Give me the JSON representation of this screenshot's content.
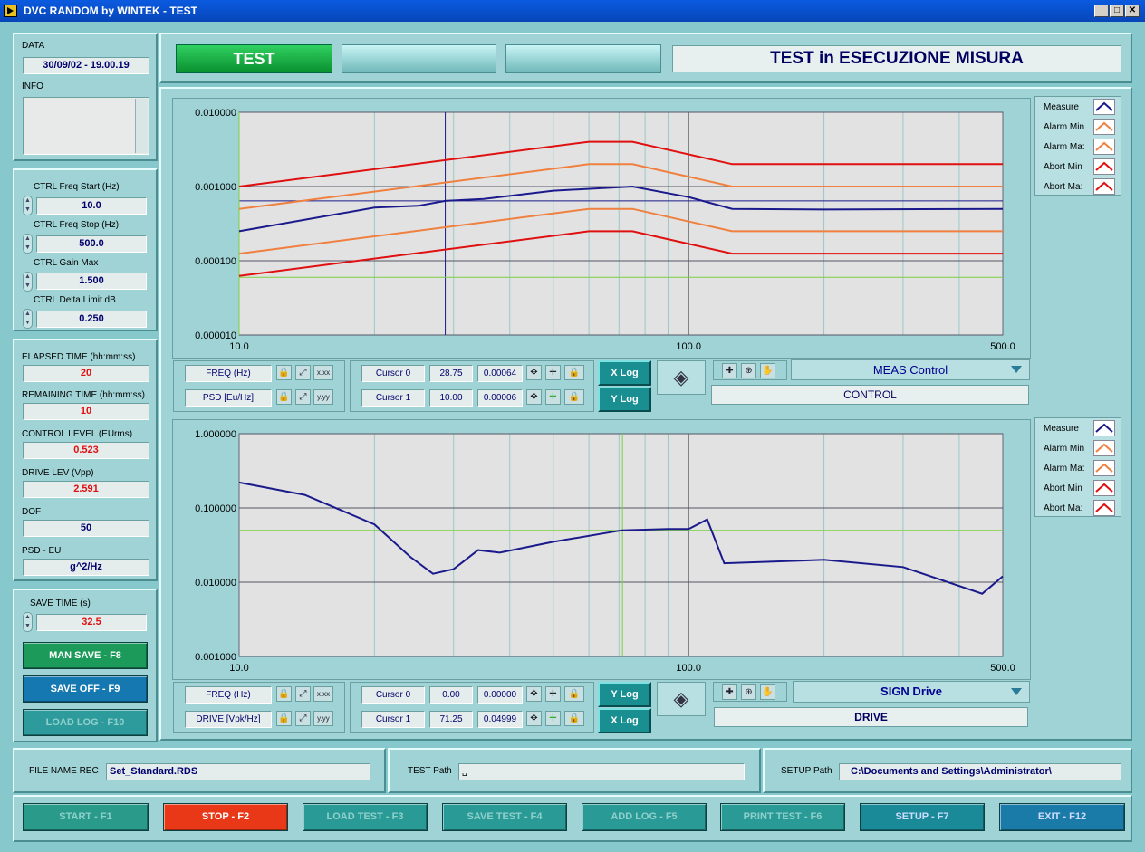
{
  "window": {
    "title": "DVC RANDOM by WINTEK - TEST",
    "min": "_",
    "max": "□",
    "close": "✕"
  },
  "left": {
    "data_label": "DATA",
    "data_value": "30/09/02 - 19.00.19",
    "info_label": "INFO",
    "ctrl_freq_start_label": "CTRL Freq Start (Hz)",
    "ctrl_freq_start": "10.0",
    "ctrl_freq_stop_label": "CTRL Freq Stop (Hz)",
    "ctrl_freq_stop": "500.0",
    "ctrl_gain_max_label": "CTRL Gain Max",
    "ctrl_gain_max": "1.500",
    "ctrl_delta_label": "CTRL Delta Limit dB",
    "ctrl_delta": "0.250",
    "elapsed_label": "ELAPSED TIME (hh:mm:ss)",
    "elapsed": "20",
    "remaining_label": "REMAINING TIME (hh:mm:ss)",
    "remaining": "10",
    "control_level_label": "CONTROL LEVEL (EUrms)",
    "control_level": "0.523",
    "drive_lev_label": "DRIVE LEV (Vpp)",
    "drive_lev": "2.591",
    "dof_label": "DOF",
    "dof": "50",
    "psd_eu_label": "PSD - EU",
    "psd_eu": "g^2/Hz",
    "save_time_label": "SAVE TIME (s)",
    "save_time": "32.5",
    "man_save": "MAN SAVE - F8",
    "save_off": "SAVE OFF - F9",
    "load_log": "LOAD LOG - F10"
  },
  "header": {
    "test_label": "TEST",
    "status": "TEST in ESECUZIONE MISURA"
  },
  "graph1": {
    "x_label": "FREQ (Hz)",
    "y_label": "PSD [Eu/Hz]",
    "cursor0": {
      "name": "Cursor 0",
      "x": "28.75",
      "y": "0.00064"
    },
    "cursor1": {
      "name": "Cursor 1",
      "x": "10.00",
      "y": "0.00006"
    },
    "xlog": "X Log",
    "ylog": "Y Log",
    "select": "MEAS Control",
    "channel": "CONTROL",
    "yticks": [
      "0.010000",
      "0.001000",
      "0.000100",
      "0.000010"
    ],
    "xticks": [
      "10.0",
      "100.0",
      "500.0"
    ],
    "fmt_x": "x.xx",
    "fmt_y": "y.yy"
  },
  "graph2": {
    "x_label": "FREQ (Hz)",
    "y_label": "DRIVE [Vpk/Hz]",
    "cursor0": {
      "name": "Cursor 0",
      "x": "0.00",
      "y": "0.00000"
    },
    "cursor1": {
      "name": "Cursor 1",
      "x": "71.25",
      "y": "0.04999"
    },
    "ylog": "Y Log",
    "xlog": "X Log",
    "select": "SIGN Drive",
    "channel": "DRIVE",
    "yticks": [
      "1.000000",
      "0.100000",
      "0.010000",
      "0.001000"
    ],
    "xticks": [
      "10.0",
      "100.0",
      "500.0"
    ],
    "fmt_x": "x.xx",
    "fmt_y": "y.yy"
  },
  "legend": {
    "items": [
      "Measure",
      "Alarm Min",
      "Alarm Ma:",
      "Abort Min",
      "Abort Ma:"
    ]
  },
  "paths": {
    "file_label": "FILE NAME REC",
    "file_value": "Set_Standard.RDS",
    "test_path_label": "TEST Path",
    "test_path_value": "",
    "setup_path_label": "SETUP Path",
    "setup_path_value": "C:\\Documents and Settings\\Administrator\\"
  },
  "bottom": {
    "start": "START - F1",
    "stop": "STOP - F2",
    "load_test": "LOAD TEST - F3",
    "save_test": "SAVE TEST - F4",
    "add_log": "ADD LOG - F5",
    "print_test": "PRINT TEST - F6",
    "setup": "SETUP - F7",
    "exit": "EXIT - F12"
  },
  "colors": {
    "measure": "#1a1a8c",
    "alarm": "#f08040",
    "abort": "#e01010",
    "cursor": "#7ad040"
  },
  "chart_data": [
    {
      "type": "line",
      "x_scale": "log",
      "y_scale": "log",
      "xlim": [
        10,
        500
      ],
      "ylim": [
        1e-05,
        0.01
      ],
      "series": [
        {
          "name": "Measure",
          "x": [
            10,
            20,
            25,
            28.75,
            35,
            50,
            75,
            100,
            125,
            200,
            500
          ],
          "y": [
            0.00025,
            0.00052,
            0.00055,
            0.00064,
            0.00068,
            0.00088,
            0.001,
            0.00072,
            0.0005,
            0.00049,
            0.0005
          ]
        },
        {
          "name": "Alarm Min",
          "x": [
            10,
            60,
            75,
            125,
            500
          ],
          "y": [
            0.000125,
            0.0005,
            0.0005,
            0.00025,
            0.00025
          ]
        },
        {
          "name": "Alarm Ma:",
          "x": [
            10,
            60,
            75,
            125,
            500
          ],
          "y": [
            0.0005,
            0.002,
            0.002,
            0.001,
            0.001
          ]
        },
        {
          "name": "Abort Min",
          "x": [
            10,
            60,
            75,
            125,
            500
          ],
          "y": [
            6.25e-05,
            0.00025,
            0.00025,
            0.000125,
            0.000125
          ]
        },
        {
          "name": "Abort Ma:",
          "x": [
            10,
            60,
            75,
            125,
            500
          ],
          "y": [
            0.001,
            0.004,
            0.004,
            0.002,
            0.002
          ]
        }
      ],
      "cursors": [
        {
          "x": 28.75,
          "y": 0.00064
        },
        {
          "x": 10,
          "y": 6e-05
        }
      ]
    },
    {
      "type": "line",
      "x_scale": "log",
      "y_scale": "log",
      "xlim": [
        10,
        500
      ],
      "ylim": [
        0.001,
        1
      ],
      "series": [
        {
          "name": "Measure",
          "x": [
            10,
            14,
            20,
            24,
            27,
            30,
            34,
            38,
            50,
            71,
            90,
            100,
            110,
            120,
            200,
            300,
            450,
            500
          ],
          "y": [
            0.22,
            0.15,
            0.06,
            0.022,
            0.013,
            0.015,
            0.027,
            0.025,
            0.035,
            0.05,
            0.052,
            0.052,
            0.07,
            0.018,
            0.02,
            0.016,
            0.007,
            0.012
          ]
        }
      ],
      "cursors": [
        {
          "x": 0,
          "y": 0
        },
        {
          "x": 71.25,
          "y": 0.04999
        }
      ]
    }
  ]
}
